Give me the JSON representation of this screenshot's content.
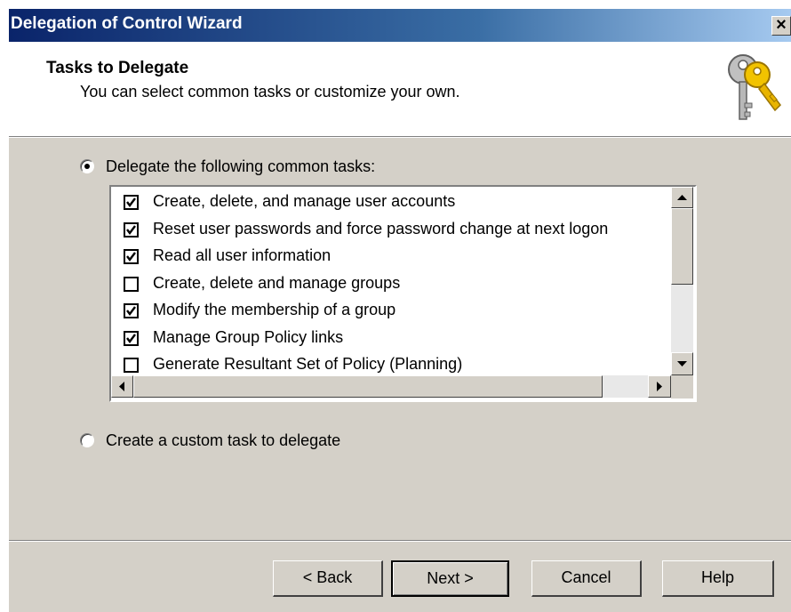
{
  "window": {
    "title": "Delegation of Control Wizard",
    "close_glyph": "×"
  },
  "header": {
    "title": "Tasks to Delegate",
    "subtitle": "You can select common tasks or customize your own.",
    "icon": "keys-icon"
  },
  "options": {
    "common": {
      "label": "Delegate the following common tasks:",
      "selected": true
    },
    "custom": {
      "label": "Create a custom task to delegate",
      "selected": false
    }
  },
  "tasks": [
    {
      "label": "Create, delete, and manage user accounts",
      "checked": true
    },
    {
      "label": "Reset user passwords and force password change at next logon",
      "checked": true
    },
    {
      "label": "Read all user information",
      "checked": true
    },
    {
      "label": "Create, delete and manage groups",
      "checked": false
    },
    {
      "label": "Modify the membership of a group",
      "checked": true
    },
    {
      "label": "Manage Group Policy links",
      "checked": true
    },
    {
      "label": "Generate Resultant Set of Policy (Planning)",
      "checked": false
    }
  ],
  "buttons": {
    "back": "< Back",
    "next": "Next >",
    "cancel": "Cancel",
    "help": "Help"
  },
  "colors": {
    "dialog_bg": "#d4d0c8",
    "title_bar_start": "#0a246a",
    "title_bar_end": "#a6caf0"
  }
}
